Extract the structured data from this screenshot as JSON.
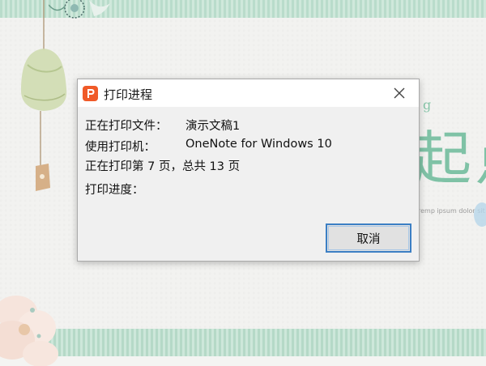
{
  "background": {
    "heading_chars": "起点",
    "small_letter": "g",
    "body_text": "remp ipsum dolor sit am",
    "accent_color": "#7fc2a6"
  },
  "dialog": {
    "title": "打印进程",
    "app_icon": "wps-presentation-icon",
    "close_icon": "close-icon",
    "rows": [
      {
        "label": "正在打印文件：",
        "value": "演示文稿1"
      },
      {
        "label": "使用打印机：",
        "value": "OneNote for Windows 10"
      },
      {
        "label": "正在打印第 7 页，总共 13 页",
        "value": ""
      },
      {
        "label": "打印进度：",
        "value": ""
      }
    ],
    "cancel_label": "取消"
  },
  "colors": {
    "icon_orange": "#f05a28",
    "button_border": "#3c7fc4"
  }
}
